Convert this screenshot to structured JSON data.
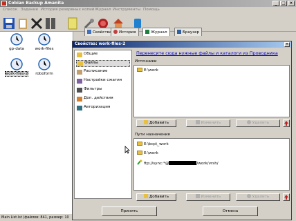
{
  "window": {
    "title": "Cobian Backup Amanita",
    "minimize": "_",
    "maximize": "□",
    "close": "×"
  },
  "menu": [
    "Список",
    "Задание",
    "История резервных копий",
    "Журнал",
    "Инструменты",
    "Помощь"
  ],
  "toolbar": {
    "icons": [
      "save-icon",
      "clipboard-icon",
      "delete-icon",
      "toggle-icon",
      "document-icon",
      "tools-icon",
      "stop-icon",
      "home-icon",
      "help-icon"
    ]
  },
  "tabs": [
    {
      "label": "Свойства",
      "icon": "properties-icon"
    },
    {
      "label": "История",
      "icon": "history-icon"
    },
    {
      "label": "Журнал",
      "icon": "log-icon"
    },
    {
      "label": "Браузер",
      "icon": "browser-icon"
    }
  ],
  "jobs": [
    {
      "label": "gp-data"
    },
    {
      "label": "work-files"
    },
    {
      "label": "work-files-2"
    },
    {
      "label": "roboform"
    }
  ],
  "status": "Main List.lst (файлов: 841, размер: 10",
  "dialog": {
    "title": "Свойства: work-files-2",
    "close": "×",
    "nav": [
      "Общие",
      "Файлы",
      "Расписание",
      "Настройки сжатия",
      "Фильтры",
      "Доп. действия",
      "Авторизация"
    ],
    "hint": "Перенесите сюда нужные файлы и каталоги из Проводника",
    "sources": {
      "label": "Источники",
      "items": [
        "E:\\work"
      ],
      "add": "Добавить",
      "edit": "Изменить",
      "delete": "Удалить"
    },
    "destinations": {
      "label": "Пути назначения",
      "items": [
        "E:\\bcp\\_work",
        "E:\\work",
        "ftp://sync:*@",
        "/work/vrsh/"
      ],
      "add": "Добавить",
      "edit": "Изменить",
      "delete": "Удалить"
    },
    "ok": "Принять",
    "cancel": "Отмена"
  },
  "colors": {
    "accent": "#0a246a",
    "link": "#0000cc",
    "folder": "#e8c040",
    "arrow": "#c02020"
  }
}
